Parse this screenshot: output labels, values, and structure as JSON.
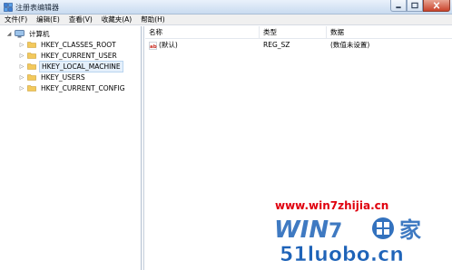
{
  "window": {
    "title": "注册表编辑器",
    "app_icon": "regedit-icon"
  },
  "menu": {
    "items": [
      "文件(F)",
      "编辑(E)",
      "查看(V)",
      "收藏夹(A)",
      "帮助(H)"
    ]
  },
  "tree": {
    "root": "计算机",
    "keys": [
      "HKEY_CLASSES_ROOT",
      "HKEY_CURRENT_USER",
      "HKEY_LOCAL_MACHINE",
      "HKEY_USERS",
      "HKEY_CURRENT_CONFIG"
    ],
    "selected": "HKEY_LOCAL_MACHINE"
  },
  "list": {
    "columns": [
      "名称",
      "类型",
      "数据"
    ],
    "rows": [
      {
        "name": "(默认)",
        "type": "REG_SZ",
        "data": "(数值未设置)",
        "icon": "string-value-icon"
      }
    ]
  },
  "watermark": {
    "url": "www.win7zhijia.cn",
    "site": "51luobo.cn",
    "brand": "WIN7之家",
    "colors": {
      "url": "#e0000e",
      "brand": "#1e63b8"
    }
  },
  "colors": {
    "titlebar": "#c9dbf0",
    "close_button": "#c9432b",
    "selection": "#e5f0fb",
    "folder": "#f3c95c"
  }
}
